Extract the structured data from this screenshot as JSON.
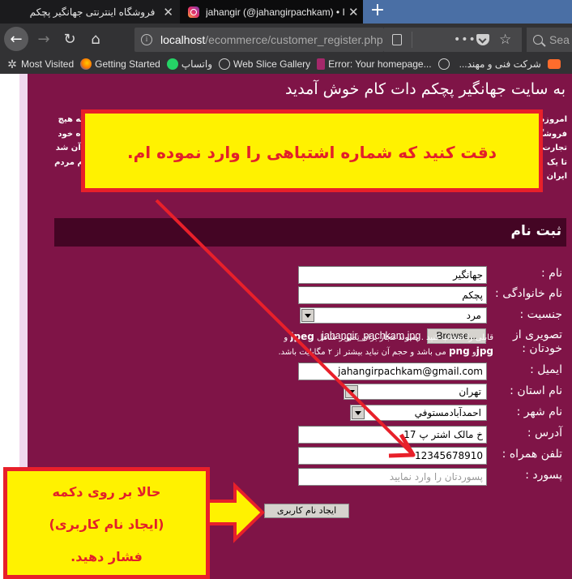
{
  "browser": {
    "tabs": [
      {
        "title": "فروشگاه اینترنتی جهانگیر پچکم",
        "active": false
      },
      {
        "title": "jahangir (@jahangirpachkam) • Ins",
        "active": true,
        "icon": "instagram-icon"
      }
    ],
    "new_tab_label": "+",
    "close_label": "✕",
    "url_host": "localhost",
    "url_path": "/ecommerce/customer_register.php",
    "search_placeholder": "Sea",
    "nav_icons": {
      "back": "←",
      "forward": "→",
      "reload": "↻",
      "home": "⌂",
      "more": "•••",
      "star": "☆",
      "info": "i"
    },
    "bookmarks": [
      {
        "label": "Most Visited",
        "icon": "gear-icon"
      },
      {
        "label": "Getting Started",
        "icon": "firefox-icon"
      },
      {
        "label": "واتساپ",
        "icon": "whatsapp-icon"
      },
      {
        "label": "Web Slice Gallery",
        "icon": "globe-icon"
      },
      {
        "label": "Error: Your homepage...",
        "icon": "yoast-icon"
      },
      {
        "label": "",
        "icon": "globe-icon"
      },
      {
        "label": "شرکت فنی و مهند...",
        "icon": ""
      },
      {
        "label": "",
        "icon": "cpanel-icon"
      }
    ]
  },
  "page": {
    "welcome_title": "به سایت جهانگیر پچکم دات کام خوش آمدید",
    "intro_right": [
      "امروزه",
      "فروشگ",
      "تجارت",
      "تا یک",
      "ایران"
    ],
    "intro_left": [
      "تکه هیچ",
      "گاه خود",
      "ر آن شد",
      "وم مردم",
      ""
    ],
    "register_heading": "ثبت نام",
    "form": {
      "first_name": {
        "label": "نام :",
        "value": "جهانگیر"
      },
      "last_name": {
        "label": "نام خانوادگی :",
        "value": "پچکم"
      },
      "gender": {
        "label": "جنسیت :",
        "value": "مرد"
      },
      "photo": {
        "label_line1": "تصویری از",
        "label_line2": "خودتان :",
        "browse_label": "Browse...",
        "file_name": "jahangir_pachkam.jpg",
        "hint_line1": "قابلی را انتخاب کنید . پسوند مجاز برای تصویر شامل",
        "hint_line1_bold": "jpeg",
        "hint_line1_end": "و",
        "hint_line2_bold": "jpg",
        "hint_line2_mid": "و",
        "hint_line2_bold2": "png",
        "hint_line2": "می باشد و حجم آن نباید بیشتر از ۲ مگابایت باشد."
      },
      "email": {
        "label": "ایمیل :",
        "value": "jahangirpachkam@gmail.com"
      },
      "province": {
        "label": "نام استان :",
        "value": "تهران"
      },
      "city": {
        "label": "نام شهر :",
        "value": "احمدآبادمستوفي"
      },
      "address": {
        "label": "آدرس :",
        "value": "خ مالک اشتر پ 17"
      },
      "mobile": {
        "label": "تلفن همراه :",
        "value": "12345678910"
      },
      "password": {
        "label": "پسورد :",
        "placeholder": "پسوردتان را وارد نمایید"
      },
      "submit_label": "ایجاد نام کاربری"
    }
  },
  "annotations": {
    "callout_top": "دقت کنید که شماره اشتباهی را وارد نموده ام.",
    "callout_bottom_lines": [
      "حالا بر روی دکمه",
      "(ایجاد نام کاربری)",
      "فشار دهید."
    ],
    "accent_colors": {
      "callout_fill": "#fff200",
      "callout_border": "#e8202a",
      "page_bg": "#7f1447",
      "heading_bar": "#440524"
    }
  }
}
